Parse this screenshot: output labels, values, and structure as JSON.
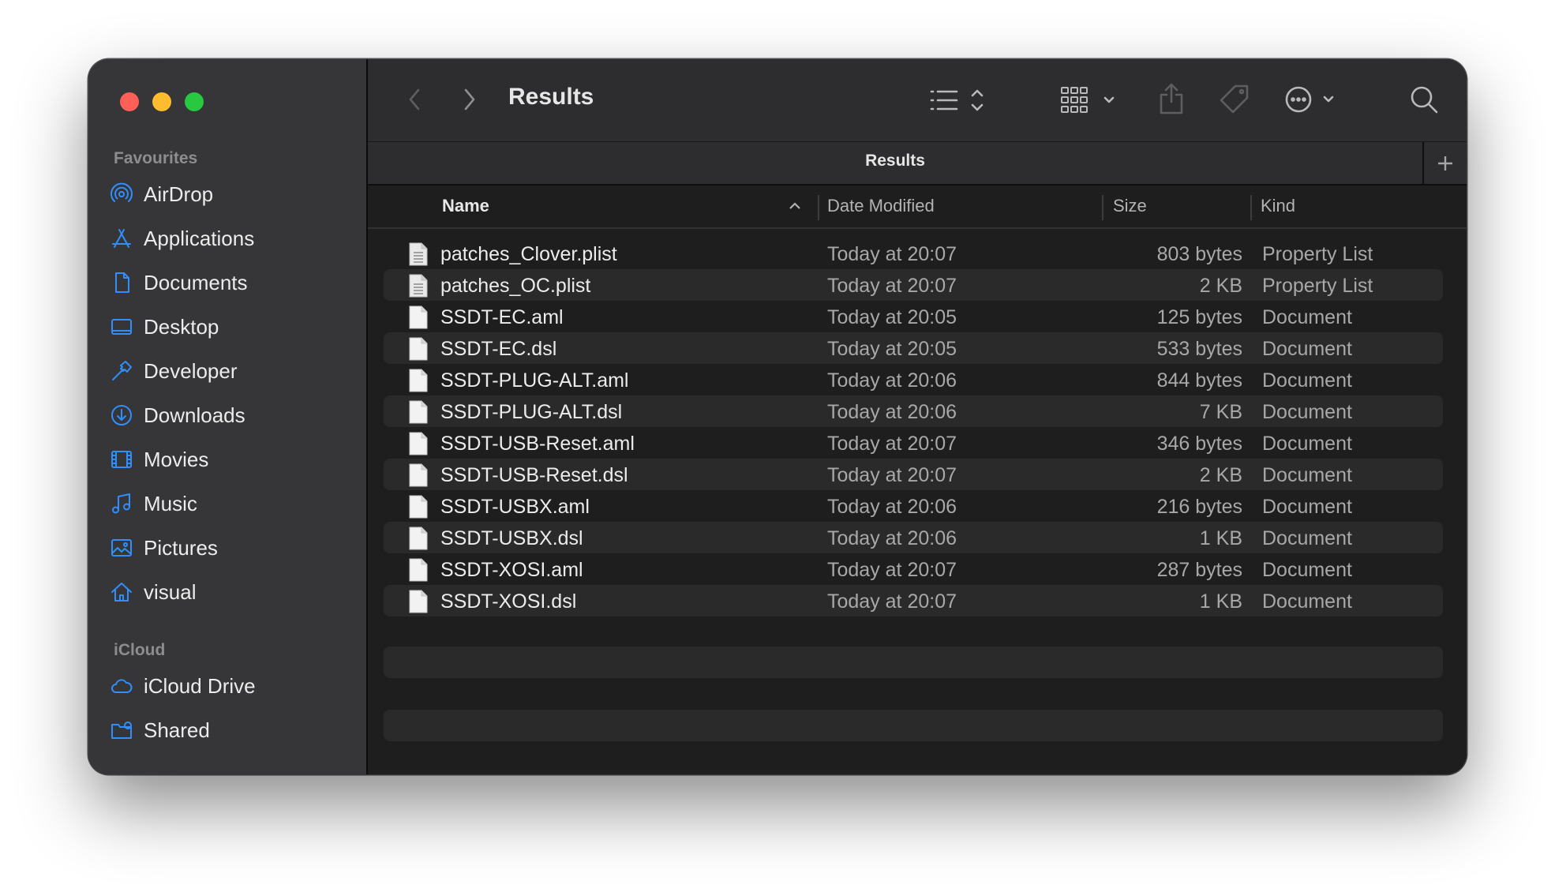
{
  "window": {
    "title": "Results",
    "tab_label": "Results"
  },
  "sidebar": {
    "favourites_title": "Favourites",
    "favourites": [
      {
        "label": "AirDrop",
        "icon": "airdrop-icon"
      },
      {
        "label": "Applications",
        "icon": "applications-icon"
      },
      {
        "label": "Documents",
        "icon": "document-icon"
      },
      {
        "label": "Desktop",
        "icon": "desktop-icon"
      },
      {
        "label": "Developer",
        "icon": "hammer-icon"
      },
      {
        "label": "Downloads",
        "icon": "download-icon"
      },
      {
        "label": "Movies",
        "icon": "film-icon"
      },
      {
        "label": "Music",
        "icon": "music-note-icon"
      },
      {
        "label": "Pictures",
        "icon": "photo-icon"
      },
      {
        "label": "visual",
        "icon": "home-icon"
      }
    ],
    "icloud_title": "iCloud",
    "icloud": [
      {
        "label": "iCloud Drive",
        "icon": "cloud-icon"
      },
      {
        "label": "Shared",
        "icon": "shared-folder-icon"
      }
    ]
  },
  "columns": {
    "name": "Name",
    "date": "Date Modified",
    "size": "Size",
    "kind": "Kind"
  },
  "files": [
    {
      "name": "patches_Clover.plist",
      "date": "Today at 20:07",
      "size": "803 bytes",
      "kind": "Property List",
      "icon": "plist-file-icon"
    },
    {
      "name": "patches_OC.plist",
      "date": "Today at 20:07",
      "size": "2 KB",
      "kind": "Property List",
      "icon": "plist-file-icon"
    },
    {
      "name": "SSDT-EC.aml",
      "date": "Today at 20:05",
      "size": "125 bytes",
      "kind": "Document",
      "icon": "document-file-icon"
    },
    {
      "name": "SSDT-EC.dsl",
      "date": "Today at 20:05",
      "size": "533 bytes",
      "kind": "Document",
      "icon": "document-file-icon"
    },
    {
      "name": "SSDT-PLUG-ALT.aml",
      "date": "Today at 20:06",
      "size": "844 bytes",
      "kind": "Document",
      "icon": "document-file-icon"
    },
    {
      "name": "SSDT-PLUG-ALT.dsl",
      "date": "Today at 20:06",
      "size": "7 KB",
      "kind": "Document",
      "icon": "document-file-icon"
    },
    {
      "name": "SSDT-USB-Reset.aml",
      "date": "Today at 20:07",
      "size": "346 bytes",
      "kind": "Document",
      "icon": "document-file-icon"
    },
    {
      "name": "SSDT-USB-Reset.dsl",
      "date": "Today at 20:07",
      "size": "2 KB",
      "kind": "Document",
      "icon": "document-file-icon"
    },
    {
      "name": "SSDT-USBX.aml",
      "date": "Today at 20:06",
      "size": "216 bytes",
      "kind": "Document",
      "icon": "document-file-icon"
    },
    {
      "name": "SSDT-USBX.dsl",
      "date": "Today at 20:06",
      "size": "1 KB",
      "kind": "Document",
      "icon": "document-file-icon"
    },
    {
      "name": "SSDT-XOSI.aml",
      "date": "Today at 20:07",
      "size": "287 bytes",
      "kind": "Document",
      "icon": "document-file-icon"
    },
    {
      "name": "SSDT-XOSI.dsl",
      "date": "Today at 20:07",
      "size": "1 KB",
      "kind": "Document",
      "icon": "document-file-icon"
    }
  ],
  "colors": {
    "accent": "#2f8ffd",
    "close": "#fe5f57",
    "minimize": "#febc2e",
    "zoom": "#28c840"
  }
}
